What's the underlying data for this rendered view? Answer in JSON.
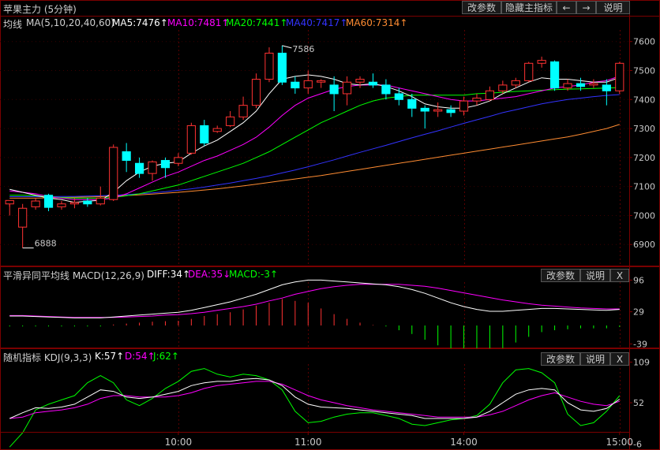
{
  "main": {
    "title": "苹果主力 (5分钟)",
    "buttons": {
      "params": "改参数",
      "hide_main": "隐藏主指标",
      "prev": "←",
      "next": "→",
      "help": "说明"
    },
    "legend": {
      "ma_label": "均线",
      "ma_params": "MA(5,10,20,40,60)",
      "ma5": "MA5:7476↑",
      "ma10": "MA10:7481↑",
      "ma20": "MA20:7441↑",
      "ma40": "MA40:7417↑",
      "ma60": "MA60:7314↑"
    },
    "annotations": {
      "high": "7586",
      "low": "6888"
    }
  },
  "macd": {
    "legend": {
      "title": "平滑异同平均线 MACD(12,26,9)",
      "diff": "DIFF:34↑",
      "dea": "DEA:35↓",
      "macd": "MACD:-3↑"
    },
    "buttons": {
      "params": "改参数",
      "help": "说明",
      "close": "X"
    }
  },
  "kdj": {
    "legend": {
      "title": "随机指标 KDJ(9,3,3)",
      "k": "K:57↑",
      "d": "D:54↑",
      "j": "J:62↑"
    },
    "buttons": {
      "params": "改参数",
      "help": "说明",
      "close": "X"
    }
  },
  "colors": {
    "up": "#ff3232",
    "down": "#00ffff",
    "ma5": "#ffffff",
    "ma10": "#ff00ff",
    "ma20": "#00ff00",
    "ma40": "#3333ff",
    "ma60": "#ff8c32"
  },
  "chart_data": [
    {
      "type": "candlestick",
      "title": "苹果主力 (5分钟)",
      "ylim": [
        6830,
        7640
      ],
      "y_ticks": [
        "7600",
        "7500",
        "7400",
        "7300",
        "7200",
        "7100",
        "7000",
        "6900"
      ],
      "x_ticks": [
        "10:00",
        "11:00",
        "14:00",
        "15:00"
      ],
      "x_tick_index": [
        13,
        23,
        35,
        47
      ],
      "candles": [
        [
          7040,
          7052,
          7030,
          7000
        ],
        [
          6960,
          7025,
          7040,
          6888
        ],
        [
          7030,
          7050,
          7060,
          7020
        ],
        [
          7070,
          7028,
          7075,
          7015
        ],
        [
          7030,
          7040,
          7050,
          7020
        ],
        [
          7040,
          7045,
          7060,
          7025
        ],
        [
          7050,
          7040,
          7060,
          7030
        ],
        [
          7040,
          7060,
          7100,
          7035
        ],
        [
          7055,
          7235,
          7245,
          7050
        ],
        [
          7220,
          7190,
          7250,
          7150
        ],
        [
          7180,
          7145,
          7200,
          7130
        ],
        [
          7145,
          7185,
          7190,
          7120
        ],
        [
          7190,
          7165,
          7200,
          7130
        ],
        [
          7180,
          7200,
          7215,
          7170
        ],
        [
          7215,
          7310,
          7320,
          7210
        ],
        [
          7310,
          7250,
          7330,
          7240
        ],
        [
          7290,
          7300,
          7310,
          7285
        ],
        [
          7310,
          7340,
          7360,
          7305
        ],
        [
          7340,
          7380,
          7410,
          7330
        ],
        [
          7380,
          7470,
          7490,
          7370
        ],
        [
          7470,
          7560,
          7580,
          7460
        ],
        [
          7560,
          7460,
          7586,
          7450
        ],
        [
          7460,
          7440,
          7480,
          7420
        ],
        [
          7440,
          7465,
          7500,
          7420
        ],
        [
          7460,
          7465,
          7470,
          7440
        ],
        [
          7450,
          7420,
          7480,
          7360
        ],
        [
          7420,
          7460,
          7480,
          7380
        ],
        [
          7460,
          7470,
          7480,
          7440
        ],
        [
          7460,
          7450,
          7490,
          7440
        ],
        [
          7450,
          7420,
          7470,
          7400
        ],
        [
          7420,
          7400,
          7440,
          7380
        ],
        [
          7400,
          7370,
          7420,
          7340
        ],
        [
          7370,
          7360,
          7380,
          7300
        ],
        [
          7360,
          7365,
          7390,
          7340
        ],
        [
          7365,
          7355,
          7380,
          7340
        ],
        [
          7360,
          7395,
          7410,
          7345
        ],
        [
          7395,
          7405,
          7420,
          7380
        ],
        [
          7400,
          7430,
          7445,
          7395
        ],
        [
          7430,
          7450,
          7465,
          7420
        ],
        [
          7450,
          7465,
          7475,
          7440
        ],
        [
          7465,
          7525,
          7530,
          7460
        ],
        [
          7525,
          7535,
          7548,
          7510
        ],
        [
          7530,
          7440,
          7535,
          7430
        ],
        [
          7440,
          7455,
          7470,
          7430
        ],
        [
          7455,
          7445,
          7475,
          7430
        ],
        [
          7450,
          7455,
          7470,
          7440
        ],
        [
          7450,
          7430,
          7470,
          7380
        ],
        [
          7430,
          7525,
          7530,
          7420
        ]
      ],
      "series": [
        {
          "name": "MA5",
          "values": [
            7090,
            7080,
            7070,
            7060,
            7055,
            7045,
            7050,
            7052,
            7080,
            7120,
            7150,
            7170,
            7180,
            7185,
            7215,
            7240,
            7260,
            7290,
            7320,
            7360,
            7420,
            7470,
            7480,
            7485,
            7480,
            7470,
            7455,
            7450,
            7455,
            7445,
            7430,
            7410,
            7385,
            7375,
            7370,
            7370,
            7380,
            7395,
            7420,
            7440,
            7460,
            7475,
            7470,
            7470,
            7465,
            7460,
            7460,
            7476
          ]
        },
        {
          "name": "MA10",
          "values": [
            7085,
            7080,
            7075,
            7065,
            7060,
            7055,
            7055,
            7055,
            7060,
            7075,
            7095,
            7115,
            7135,
            7150,
            7170,
            7190,
            7205,
            7225,
            7245,
            7270,
            7305,
            7345,
            7380,
            7405,
            7420,
            7435,
            7445,
            7450,
            7450,
            7450,
            7440,
            7430,
            7420,
            7410,
            7400,
            7395,
            7395,
            7400,
            7405,
            7410,
            7420,
            7430,
            7440,
            7445,
            7450,
            7460,
            7465,
            7481
          ]
        },
        {
          "name": "MA20",
          "values": [
            7070,
            7070,
            7068,
            7065,
            7062,
            7060,
            7060,
            7060,
            7062,
            7068,
            7075,
            7085,
            7095,
            7105,
            7120,
            7135,
            7150,
            7165,
            7180,
            7200,
            7220,
            7245,
            7270,
            7295,
            7320,
            7340,
            7360,
            7380,
            7395,
            7405,
            7410,
            7415,
            7415,
            7415,
            7415,
            7415,
            7420,
            7422,
            7425,
            7428,
            7430,
            7432,
            7434,
            7436,
            7437,
            7438,
            7440,
            7441
          ]
        },
        {
          "name": "MA40",
          "values": [
            7065,
            7065,
            7065,
            7065,
            7066,
            7066,
            7067,
            7068,
            7070,
            7072,
            7075,
            7078,
            7082,
            7087,
            7092,
            7098,
            7105,
            7112,
            7120,
            7128,
            7137,
            7147,
            7157,
            7168,
            7180,
            7192,
            7205,
            7218,
            7230,
            7242,
            7255,
            7268,
            7280,
            7292,
            7305,
            7318,
            7330,
            7342,
            7355,
            7365,
            7375,
            7385,
            7393,
            7400,
            7405,
            7410,
            7414,
            7417
          ]
        },
        {
          "name": "MA60",
          "values": [
            7060,
            7060,
            7060,
            7061,
            7062,
            7063,
            7064,
            7065,
            7067,
            7069,
            7071,
            7074,
            7077,
            7080,
            7084,
            7088,
            7092,
            7097,
            7102,
            7108,
            7114,
            7120,
            7126,
            7132,
            7138,
            7145,
            7152,
            7159,
            7166,
            7173,
            7180,
            7187,
            7194,
            7201,
            7208,
            7215,
            7222,
            7229,
            7236,
            7243,
            7250,
            7257,
            7264,
            7271,
            7280,
            7290,
            7300,
            7314
          ]
        }
      ]
    },
    {
      "type": "line",
      "title": "平滑异同平均线 MACD(12,26,9)",
      "ylim": [
        -45,
        105
      ],
      "y_ticks": [
        "96",
        "29",
        "-39"
      ],
      "series": [
        {
          "name": "DIFF",
          "values": [
            20,
            20,
            19,
            18,
            17,
            16,
            16,
            16,
            18,
            20,
            22,
            24,
            26,
            28,
            32,
            38,
            44,
            50,
            58,
            66,
            76,
            86,
            92,
            96,
            96,
            94,
            92,
            90,
            88,
            86,
            82,
            76,
            68,
            58,
            48,
            40,
            34,
            30,
            30,
            32,
            34,
            36,
            36,
            35,
            34,
            33,
            32,
            34
          ]
        },
        {
          "name": "DEA",
          "values": [
            21,
            21,
            20,
            19,
            18,
            17,
            17,
            17,
            17,
            18,
            19,
            20,
            22,
            23,
            25,
            28,
            32,
            36,
            40,
            45,
            52,
            58,
            66,
            72,
            78,
            82,
            85,
            87,
            87,
            87,
            87,
            85,
            83,
            79,
            74,
            69,
            64,
            59,
            54,
            50,
            46,
            43,
            41,
            39,
            37,
            36,
            35,
            35
          ]
        },
        {
          "name": "MACD",
          "values": [
            -2,
            -2,
            -2,
            -2,
            -2,
            -2,
            -2,
            -2,
            2,
            4,
            6,
            8,
            9,
            10,
            14,
            20,
            24,
            28,
            34,
            42,
            48,
            56,
            52,
            48,
            36,
            24,
            14,
            6,
            1,
            -2,
            -10,
            -18,
            -30,
            -42,
            -52,
            -58,
            -60,
            -58,
            -48,
            -36,
            -24,
            -14,
            -10,
            -8,
            -6,
            -6,
            -6,
            -3
          ]
        }
      ]
    },
    {
      "type": "line",
      "title": "随机指标 KDJ(9,3,3)",
      "ylim": [
        -12,
        115
      ],
      "y_ticks": [
        "109",
        "52",
        "-6"
      ],
      "series": [
        {
          "name": "K",
          "values": [
            30,
            38,
            45,
            44,
            46,
            50,
            60,
            70,
            68,
            60,
            58,
            60,
            64,
            68,
            76,
            80,
            82,
            82,
            85,
            86,
            84,
            76,
            60,
            50,
            46,
            45,
            44,
            42,
            40,
            38,
            36,
            34,
            30,
            30,
            30,
            30,
            32,
            40,
            52,
            64,
            70,
            72,
            70,
            52,
            42,
            40,
            44,
            57
          ]
        },
        {
          "name": "D",
          "values": [
            30,
            32,
            38,
            40,
            42,
            45,
            50,
            58,
            62,
            62,
            60,
            60,
            60,
            62,
            66,
            72,
            76,
            78,
            80,
            82,
            82,
            78,
            70,
            62,
            56,
            52,
            48,
            45,
            42,
            40,
            38,
            36,
            34,
            32,
            32,
            32,
            32,
            35,
            40,
            48,
            56,
            62,
            66,
            60,
            54,
            50,
            48,
            54
          ]
        },
        {
          "name": "J",
          "values": [
            -10,
            10,
            42,
            50,
            56,
            62,
            80,
            90,
            80,
            56,
            48,
            58,
            72,
            82,
            96,
            100,
            92,
            88,
            92,
            90,
            84,
            70,
            40,
            24,
            26,
            32,
            36,
            38,
            38,
            34,
            30,
            22,
            20,
            24,
            28,
            30,
            34,
            50,
            80,
            98,
            100,
            94,
            80,
            36,
            20,
            24,
            40,
            62
          ]
        }
      ]
    }
  ]
}
